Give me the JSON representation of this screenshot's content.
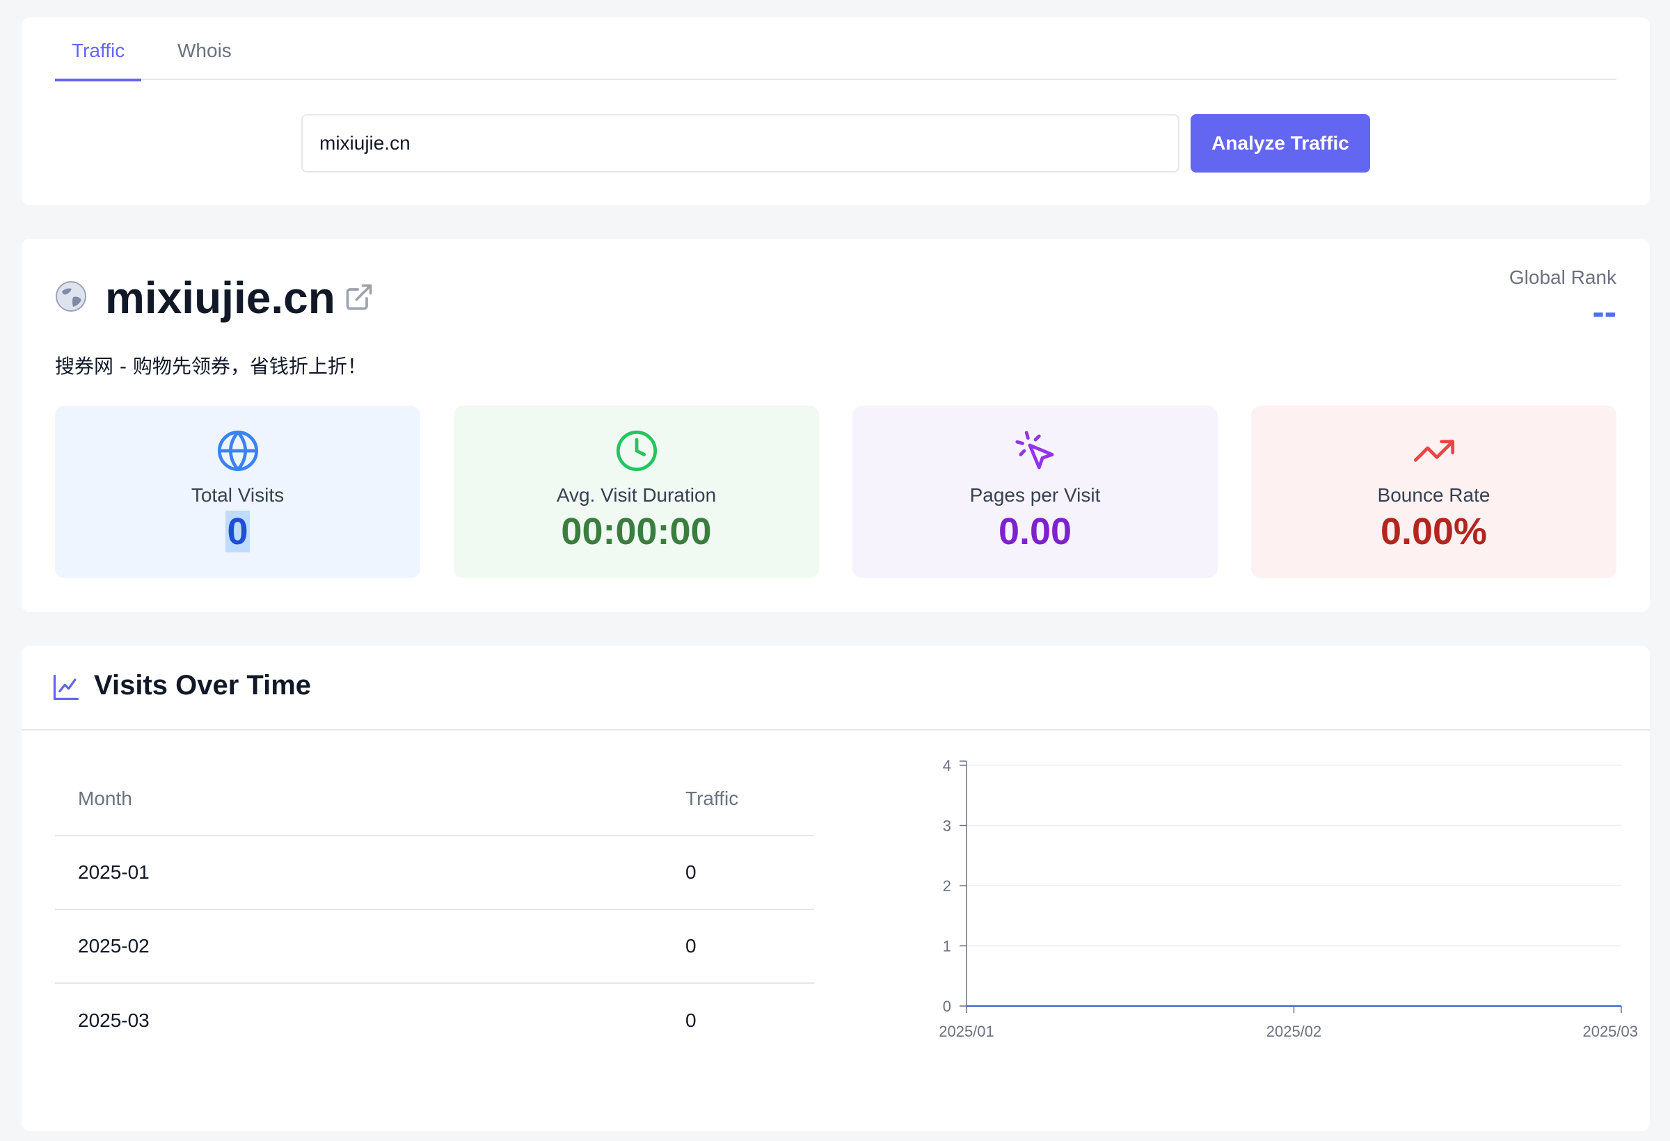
{
  "tabs": [
    {
      "label": "Traffic",
      "active": true
    },
    {
      "label": "Whois",
      "active": false
    }
  ],
  "search": {
    "value": "mixiujie.cn",
    "button_label": "Analyze Traffic"
  },
  "site": {
    "title": "mixiujie.cn",
    "description": "搜券网 - 购物先领券，省钱折上折！",
    "global_rank_label": "Global Rank",
    "global_rank_value": "--"
  },
  "stats": [
    {
      "label": "Total Visits",
      "value": "0",
      "icon": "globe-icon",
      "color": "#3b82f6"
    },
    {
      "label": "Avg. Visit Duration",
      "value": "00:00:00",
      "icon": "clock-icon",
      "color": "#22c55e"
    },
    {
      "label": "Pages per Visit",
      "value": "0.00",
      "icon": "cursor-click-icon",
      "color": "#9333ea"
    },
    {
      "label": "Bounce Rate",
      "value": "0.00%",
      "icon": "trending-up-icon",
      "color": "#ef4444"
    }
  ],
  "visits": {
    "title": "Visits Over Time",
    "table": {
      "headers": [
        "Month",
        "Traffic"
      ],
      "rows": [
        [
          "2025-01",
          "0"
        ],
        [
          "2025-02",
          "0"
        ],
        [
          "2025-03",
          "0"
        ]
      ]
    }
  },
  "chart_data": {
    "type": "line",
    "x": [
      "2025/01",
      "2025/02",
      "2025/03"
    ],
    "series": [
      {
        "values": [
          0,
          0,
          0
        ],
        "color": "#3b5bdb"
      }
    ],
    "yticks": [
      0,
      1,
      2,
      3,
      4
    ],
    "ylim": [
      0,
      4
    ],
    "grid": true
  },
  "colors": {
    "accent": "#6366f1",
    "rank": "#4f6ef7"
  }
}
